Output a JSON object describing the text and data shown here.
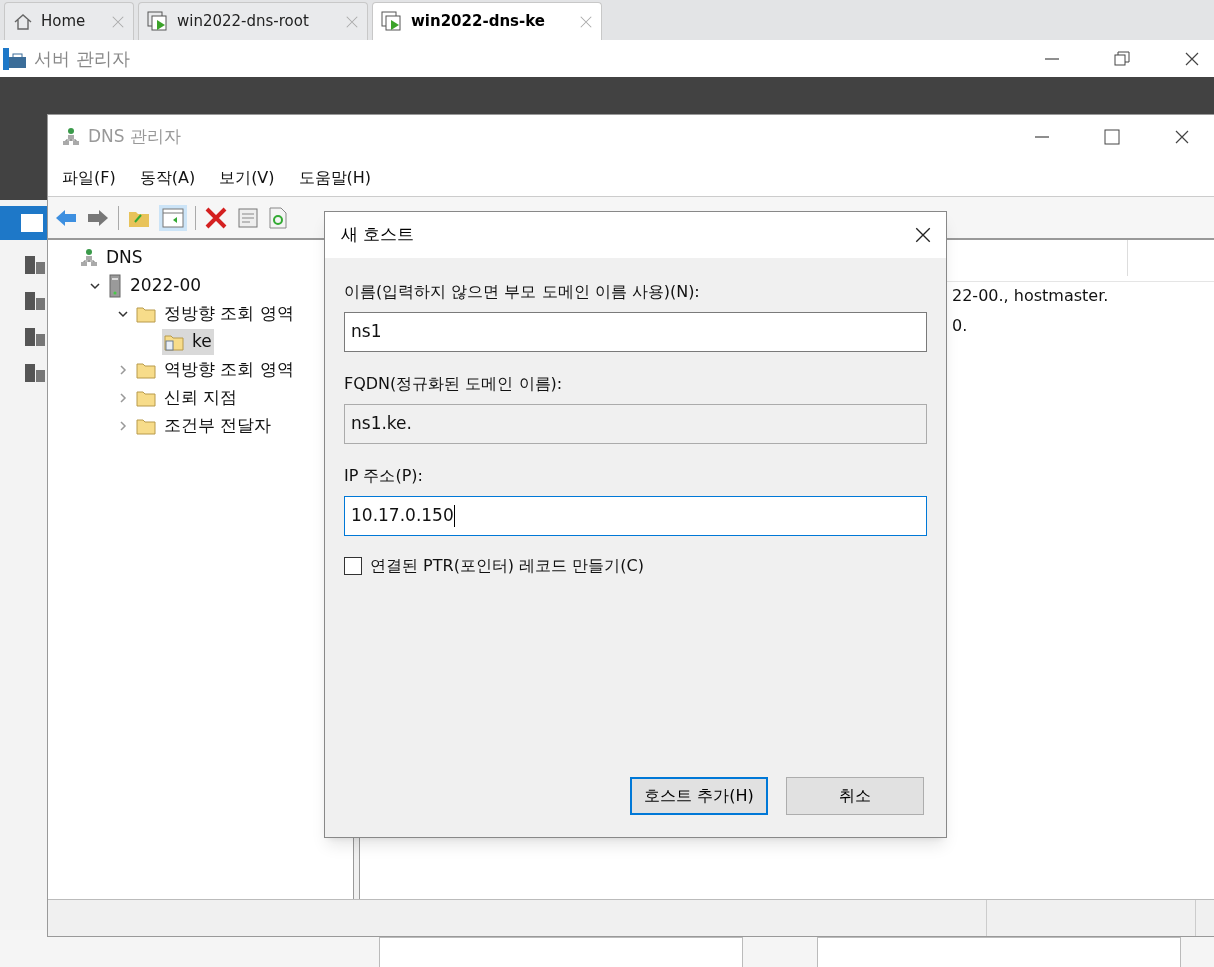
{
  "browser_tabs": [
    {
      "label": "Home",
      "kind": "home",
      "selected": false
    },
    {
      "label": "win2022-dns-root",
      "kind": "vm",
      "selected": false
    },
    {
      "label": "win2022-dns-ke",
      "kind": "vm",
      "selected": true
    }
  ],
  "server_manager": {
    "title": "서버 관리자"
  },
  "dns_window": {
    "title": "DNS 관리자",
    "menu": [
      "파일(F)",
      "동작(A)",
      "보기(V)",
      "도움말(H)"
    ],
    "tree": [
      {
        "label": "DNS",
        "kind": "dns",
        "selected": false,
        "children": [
          {
            "label": "2022-00",
            "kind": "server",
            "expanded": true,
            "selected": false,
            "children": [
              {
                "label": "정방향 조회 영역",
                "kind": "folder",
                "expanded": true,
                "selected": false,
                "children": [
                  {
                    "label": "ke",
                    "kind": "zone",
                    "selected": true
                  }
                ]
              },
              {
                "label": "역방향 조회 영역",
                "kind": "folder",
                "expanded": false,
                "selected": false
              },
              {
                "label": "신뢰 지점",
                "kind": "folder",
                "expanded": false,
                "selected": false
              },
              {
                "label": "조건부 전달자",
                "kind": "folder",
                "expanded": false,
                "selected": false
              }
            ]
          }
        ]
      }
    ],
    "detail_lines": [
      "22-00., hostmaster.",
      "0."
    ]
  },
  "dialog": {
    "title": "새 호스트",
    "fields": [
      {
        "label": "이름(입력하지 않으면 부모 도메인 이름 사용)(N):",
        "value": "ns1",
        "readonly": false,
        "focused": false
      },
      {
        "label": "FQDN(정규화된 도메인 이름):",
        "value": "ns1.ke.",
        "readonly": true,
        "focused": false
      },
      {
        "label": "IP 주소(P):",
        "value": "10.17.0.150",
        "readonly": false,
        "focused": true
      }
    ],
    "checkbox": {
      "label": "연결된 PTR(포인터) 레코드 만들기(C)",
      "checked": false
    },
    "buttons": [
      {
        "label": "호스트 추가(H)",
        "default": true
      },
      {
        "label": "취소",
        "default": false
      }
    ]
  }
}
